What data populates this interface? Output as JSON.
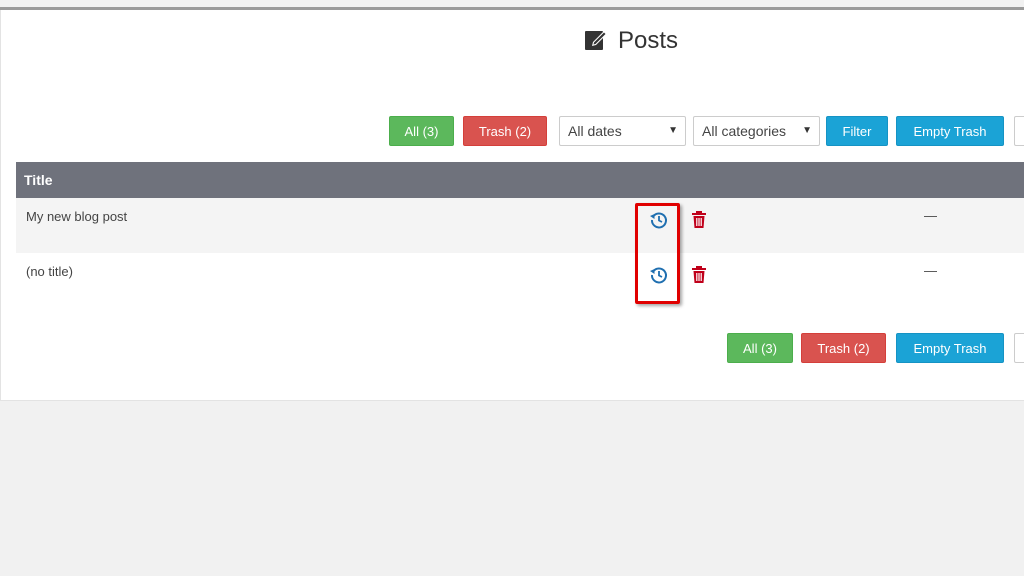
{
  "header": {
    "title": "Posts",
    "icon": "edit-square-icon"
  },
  "toolbar_top": {
    "all_label": "All (3)",
    "trash_label": "Trash (2)",
    "dates_select": {
      "value": "All dates"
    },
    "categories_select": {
      "value": "All categories"
    },
    "filter_label": "Filter",
    "empty_trash_label": "Empty Trash"
  },
  "table": {
    "columns": [
      "Title"
    ],
    "rows": [
      {
        "title": "My new blog post",
        "date": "—",
        "restore_icon": "history-restore-icon",
        "delete_icon": "trash-icon"
      },
      {
        "title": "(no title)",
        "date": "—",
        "restore_icon": "history-restore-icon",
        "delete_icon": "trash-icon"
      }
    ]
  },
  "toolbar_bottom": {
    "all_label": "All (3)",
    "trash_label": "Trash (2)",
    "empty_trash_label": "Empty Trash"
  },
  "colors": {
    "header_bg": "#6f727c",
    "green": "#5cb85c",
    "red": "#d9534f",
    "blue": "#1ba3d6",
    "restore_icon": "#1f6fb0",
    "delete_icon": "#c0001a",
    "highlight": "#e00000"
  }
}
